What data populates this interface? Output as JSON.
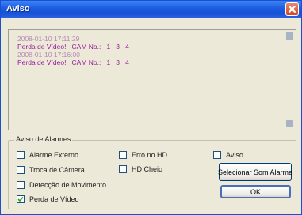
{
  "window": {
    "title": "Aviso"
  },
  "log": {
    "entries": [
      {
        "timestamp": "2008-01-10 17:11:29",
        "message": "Perda de Vídeo!   CAM No.:   1   3   4"
      },
      {
        "timestamp": "2008-01-10 17:16:00",
        "message": "Perda de Vídeo!   CAM No.:   1   3   4"
      }
    ]
  },
  "alarms": {
    "group_label": "Aviso de Alarmes",
    "checkboxes": {
      "alarme_externo": {
        "label": "Alarme Externo",
        "checked": false
      },
      "troca_camera": {
        "label": "Troca de Câmera",
        "checked": false
      },
      "deteccao_movimento": {
        "label": "Detecção de Movimento",
        "checked": false
      },
      "perda_video": {
        "label": "Perda de Vídeo",
        "checked": true
      },
      "erro_hd": {
        "label": "Erro no HD",
        "checked": false
      },
      "hd_cheio": {
        "label": "HD Cheio",
        "checked": false
      },
      "aviso": {
        "label": "Aviso",
        "checked": false
      }
    }
  },
  "buttons": {
    "select_sound_label": "Selecionar Som Alarme",
    "ok_label": "OK"
  },
  "icons": {
    "close": "close-icon",
    "check": "checkmark-icon"
  },
  "colors": {
    "titlebar": "#1d5fe0",
    "timestamp": "#b58ab5",
    "message": "#9a1a9a",
    "dialog_bg": "#ece9d8"
  }
}
